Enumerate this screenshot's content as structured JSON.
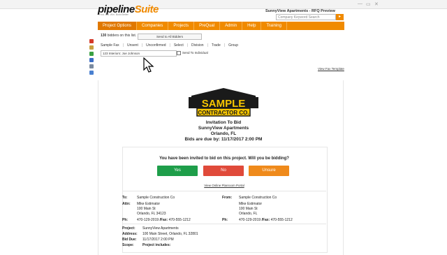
{
  "browser": {
    "win_min": "—",
    "win_max": "▭",
    "win_close": "✕"
  },
  "header": {
    "logo_pipeline": "pipeline",
    "logo_suite": "Suite",
    "tagline": "Find. Bid. Win. Build Better",
    "project_title": "SunnyView Apartments - RFQ Preview",
    "search_placeholder": "Company Keyword Search",
    "search_button": "▸"
  },
  "nav": {
    "items": [
      "Project Options",
      "Companies",
      "Projects",
      "PreQual",
      "Admin",
      "Help",
      "Training"
    ]
  },
  "bidders": {
    "count_text": "130",
    "count_suffix": "bidders on this list.",
    "send_all": "Send to All Bidders"
  },
  "filters": {
    "items": [
      "Sample Fax",
      "Unsent",
      "Unconfirmed",
      "Select",
      "Division",
      "Trade",
      "Group"
    ],
    "separator": "|",
    "bidder_value": "123 Interiors: Joe Johnson",
    "send_individual": "Send To Individual"
  },
  "view_template": "View Fax Template",
  "sample_logo": {
    "top": "SAMPLE",
    "bottom": "CONTRACTOR CO."
  },
  "bid": {
    "title": "Invitation To Bid",
    "project": "SunnyView Apartments",
    "location": "Orlando, FL",
    "due": "Bids are due by: 11/17/2017 2:00 PM"
  },
  "invite": {
    "question": "You have been invited to bid on this project. Will you be bidding?",
    "yes": "Yes",
    "no": "No",
    "unsure": "Unsure",
    "planroom_link": "View Online Planroom Portal"
  },
  "to_block": {
    "to_label": "To:",
    "to_value": "Sample Construction Co",
    "attn_label": "Attn:",
    "attn_value": "Mike Estimator",
    "addr1": "100 Main St",
    "addr2": "Orlando, FL 34123",
    "ph_label": "Ph:",
    "ph_value": "470-129-2019",
    "fax_label": "/Fax:",
    "fax_value": "470-555-1212"
  },
  "from_block": {
    "from_label": "From:",
    "from_value": "Sample Construction Co",
    "name": "Mike Estimator",
    "addr1": "100 Main St",
    "addr2": "Orlando, FL",
    "ph_label": "Ph:",
    "ph_value": "470-129-2019",
    "fax_label": "/Fax:",
    "fax_value": "470-555-1212"
  },
  "project_block": {
    "project_label": "Project:",
    "project_value": "SunnyView Apartments",
    "address_label": "Address:",
    "address_value": "100 Main Street, Orlando, FL 32801",
    "biddue_label": "Bid Due:",
    "biddue_value": "11/17/2017 2:00 PM",
    "scope_label": "Scope:",
    "scope_value": "Project includes:"
  },
  "colors": {
    "orange": "#f08a00",
    "yes": "#1e9e4a",
    "no": "#e04a3a",
    "unsure": "#ef8a1b",
    "logo_black": "#1a1a1a",
    "logo_yellow": "#f7c600"
  }
}
